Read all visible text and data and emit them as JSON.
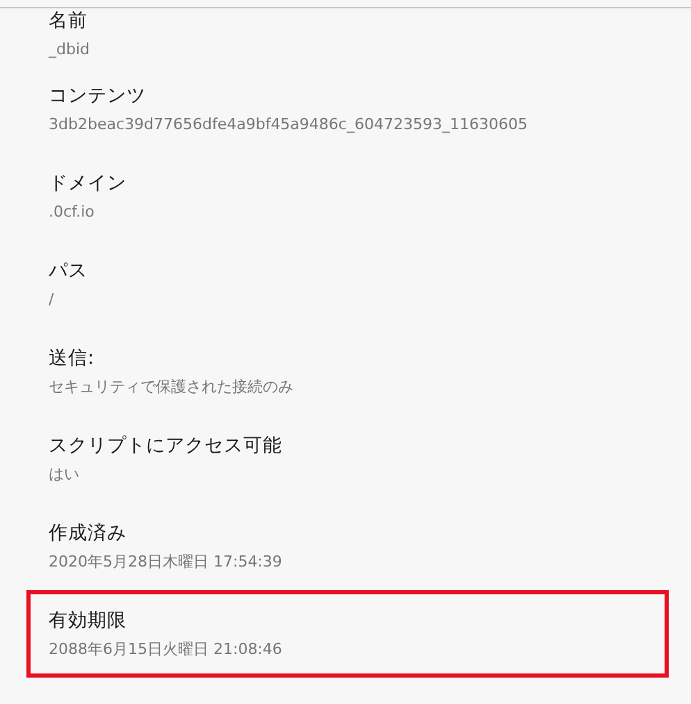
{
  "properties": [
    {
      "label": "名前",
      "value": "_dbid",
      "highlighted": false
    },
    {
      "label": "コンテンツ",
      "value": "3db2beac39d77656dfe4a9bf45a9486c_604723593_11630605",
      "highlighted": false
    },
    {
      "label": "ドメイン",
      "value": ".0cf.io",
      "highlighted": false
    },
    {
      "label": "パス",
      "value": "/",
      "highlighted": false
    },
    {
      "label": "送信:",
      "value": "セキュリティで保護された接続のみ",
      "highlighted": false
    },
    {
      "label": "スクリプトにアクセス可能",
      "value": "はい",
      "highlighted": false
    },
    {
      "label": "作成済み",
      "value": "2020年5月28日木曜日 17:54:39",
      "highlighted": false
    },
    {
      "label": "有効期限",
      "value": "2088年6月15日火曜日 21:08:46",
      "highlighted": true
    }
  ]
}
